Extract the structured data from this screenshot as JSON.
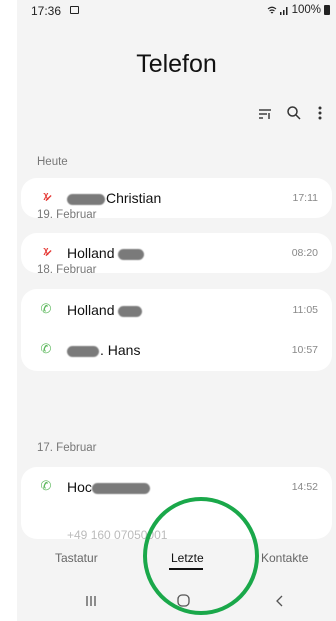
{
  "status_bar": {
    "time": "17:36",
    "battery": "100%",
    "icons": [
      "image-icon",
      "wifi-icon",
      "signal-icon",
      "battery-icon"
    ]
  },
  "app": {
    "title": "Telefon"
  },
  "toolbar": {
    "icons": [
      "filter-icon",
      "search-icon",
      "more-icon"
    ]
  },
  "sections": [
    {
      "label": "Heute"
    },
    {
      "label": "19. Februar"
    },
    {
      "label": "18. Februar"
    },
    {
      "label": "17. Februar"
    }
  ],
  "calls": [
    {
      "type": "missed",
      "name_visible": "Christian",
      "time": "17:11"
    },
    {
      "type": "missed",
      "name_visible": "Holland",
      "time": "08:20"
    },
    {
      "type": "incoming",
      "name_visible": "Holland",
      "time": "11:05"
    },
    {
      "type": "incoming",
      "name_visible": ". Hans",
      "time": "10:57"
    },
    {
      "type": "incoming",
      "name_visible": "Hoc",
      "time": "14:52"
    }
  ],
  "partial_row": {
    "number": "+49 160 07050001"
  },
  "tabs": {
    "items": [
      "Tastatur",
      "Letzte",
      "Kontakte"
    ],
    "active": "Letzte"
  },
  "navbar": {
    "icons": [
      "recents-icon",
      "home-icon",
      "back-icon"
    ]
  },
  "colors": {
    "missed": "#e53935",
    "incoming": "#5cb85c",
    "highlight_circle": "#1aa84a"
  }
}
